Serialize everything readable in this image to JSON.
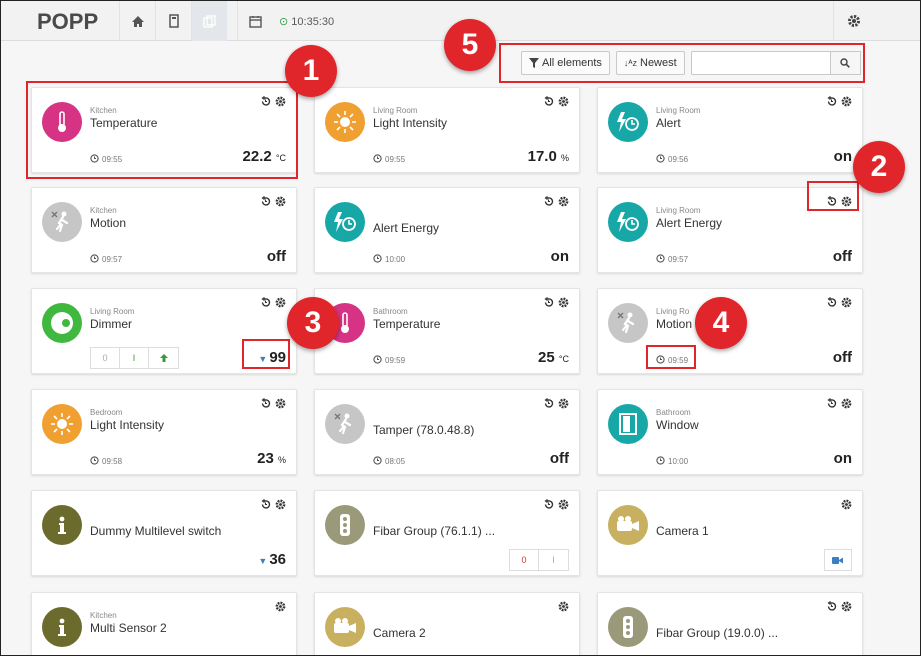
{
  "header": {
    "logo": "POPP",
    "time": "10:35:30"
  },
  "filters": {
    "all_label": "All elements",
    "sort_label": "Newest",
    "search_placeholder": ""
  },
  "cards": [
    {
      "room": "Kitchen",
      "name": "Temperature",
      "time": "09:55",
      "value": "22.2",
      "unit": "°C",
      "icon": "thermometer-icon",
      "icon_color": "#d63384"
    },
    {
      "room": "Living Room",
      "name": "Light Intensity",
      "time": "09:55",
      "value": "17.0",
      "unit": "%",
      "icon": "sun-icon",
      "icon_color": "#f0a030"
    },
    {
      "room": "Living Room",
      "name": "Alert",
      "time": "09:56",
      "value": "on",
      "unit": "",
      "icon": "alarm-clock-icon",
      "icon_color": "#18a7a7"
    },
    {
      "room": "Kitchen",
      "name": "Motion",
      "time": "09:57",
      "value": "off",
      "unit": "",
      "icon": "motion-icon",
      "icon_color": "#c6c6c6"
    },
    {
      "room": "",
      "name": "Alert Energy",
      "time": "10:00",
      "value": "on",
      "unit": "",
      "icon": "alarm-clock-icon",
      "icon_color": "#18a7a7"
    },
    {
      "room": "Living Room",
      "name": "Alert Energy",
      "time": "09:57",
      "value": "off",
      "unit": "",
      "icon": "alarm-clock-icon",
      "icon_color": "#18a7a7"
    },
    {
      "room": "Living Room",
      "name": "Dimmer",
      "time": "",
      "value": "99",
      "unit": "",
      "icon": "dimmer-icon",
      "icon_color": "#40b840",
      "dim_off": "0",
      "dim_on": "I"
    },
    {
      "room": "Bathroom",
      "name": "Temperature",
      "time": "09:59",
      "value": "25",
      "unit": "°C",
      "icon": "thermometer-icon",
      "icon_color": "#d63384"
    },
    {
      "room": "Living Ro",
      "name": "Motion",
      "time": "09:59",
      "value": "off",
      "unit": "",
      "icon": "motion-icon",
      "icon_color": "#c6c6c6"
    },
    {
      "room": "Bedroom",
      "name": "Light Intensity",
      "time": "09:58",
      "value": "23",
      "unit": "%",
      "icon": "sun-icon",
      "icon_color": "#f0a030"
    },
    {
      "room": "",
      "name": "Tamper (78.0.48.8)",
      "time": "08:05",
      "value": "off",
      "unit": "",
      "icon": "motion-icon",
      "icon_color": "#c6c6c6"
    },
    {
      "room": "Bathroom",
      "name": "Window",
      "time": "10:00",
      "value": "on",
      "unit": "",
      "icon": "window-icon",
      "icon_color": "#18a7a7"
    },
    {
      "room": "",
      "name": "Dummy Multilevel switch",
      "time": "",
      "value": "36",
      "unit": "",
      "icon": "info-icon",
      "icon_color": "#6b6b2e"
    },
    {
      "room": "",
      "name": "Fibar Group (76.1.1) ...",
      "time": "",
      "value": "",
      "unit": "",
      "icon": "traffic-light-icon",
      "icon_color": "#9a9a7a",
      "btn_off": "0",
      "btn_on": "I"
    },
    {
      "room": "",
      "name": "Camera 1",
      "time": "",
      "value": "",
      "unit": "",
      "icon": "camera-icon",
      "icon_color": "#c8b060"
    },
    {
      "room": "Kitchen",
      "name": "Multi Sensor 2",
      "time": "",
      "value": "",
      "unit": "",
      "icon": "info-icon",
      "icon_color": "#6b6b2e"
    },
    {
      "room": "",
      "name": "Camera 2",
      "time": "",
      "value": "",
      "unit": "",
      "icon": "camera-icon",
      "icon_color": "#c8b060"
    },
    {
      "room": "",
      "name": "Fibar Group (19.0.0) ...",
      "time": "",
      "value": "",
      "unit": "",
      "icon": "traffic-light-icon",
      "icon_color": "#9a9a7a"
    }
  ],
  "callouts": [
    "1",
    "2",
    "3",
    "4",
    "5"
  ]
}
